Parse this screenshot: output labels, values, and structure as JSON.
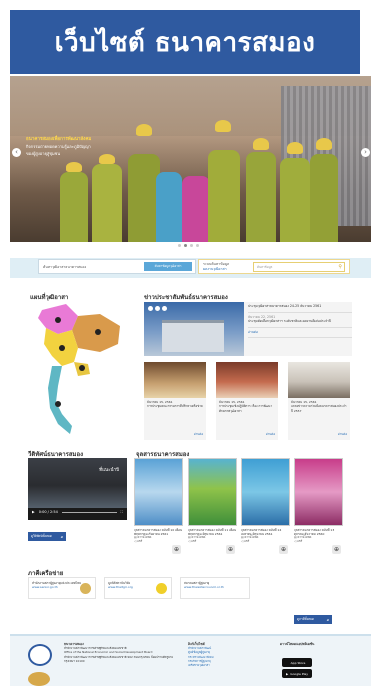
{
  "banner": {
    "title": "เว็บไซต์ ธนาคารสมอง"
  },
  "hero": {
    "caption_title": "ธนาคารสมองเพื่อการพัฒนาสังคม",
    "caption_lines": [
      "กิจกรรมถ่ายทอดความรู้และภูมิปัญญา",
      "ของผู้สูงอายุสู่ชุมชน"
    ],
    "prev_icon": "‹",
    "next_icon": "›"
  },
  "search": {
    "label": "ค้นหาวุฒิอาสาธนาคารสมอง",
    "button": "ค้นหาข้อมูลวุฒิอาสา",
    "info_label": "ระบบค้นหาข้อมูล",
    "info_link": "ผลงานวุฒิอาสา",
    "input_placeholder": "ค้นหาข้อมูล"
  },
  "sections": {
    "map_title": "แผนที่วุฒิอาสา",
    "news_title": "ข่าวประชาสัมพันธ์ธนาคารสมอง",
    "video_title": "วีดิทัศน์ธนาคารสมอง",
    "pub_title": "จุลสารธนาคารสมอง",
    "partner_title": "ภาคีเครือข่าย"
  },
  "news_main": {
    "items": [
      {
        "date": "",
        "text": "ประชุมวุฒิอาสาธนาคารสมอง 24-25 ธันวาคม 2561"
      },
      {
        "date": "ธันวาคม 22, 2561",
        "text": "ประชุมคัดเลือกวุฒิอาสาฯ ระดับชาติและผลงานดีเด่นประจำปี"
      },
      {
        "date": "",
        "text": "อ่านต่อ"
      }
    ]
  },
  "news_cards": [
    {
      "date": "ธันวาคม 15, 2561",
      "text": "การประชุมคณะกรรมการที่ปรึกษาเครือข่าย",
      "more": "อ่านต่อ"
    },
    {
      "date": "ธันวาคม 15, 2561",
      "text": "การประชุมเชิงปฏิบัติการ เรื่อง การพัฒนาศักยภาพวุฒิอาสา",
      "more": "อ่านต่อ"
    },
    {
      "date": "ธันวาคม 15, 2561",
      "text": "แถลงข่าวความร่วมมือธนาคารสมองประจำปี 2557",
      "more": "อ่านต่อ"
    }
  ],
  "video": {
    "overlay": "ที่แนะนำปี",
    "time": "0:00 / 2:54",
    "button": "ดูวีดิทัศน์ทั้งหมด"
  },
  "publications": [
    {
      "title": "จุลสารธนาคารสมอง ฉบับที่ 10 เดือนพฤษภาคม-กันยายน 2561",
      "views": "ดาวน์โหลด",
      "share": "แชร์"
    },
    {
      "title": "จุลสารธนาคารสมอง ฉบับที่ 11 เดือนพฤษภาคม-มิถุนายน 2561",
      "views": "ดาวน์โหลด",
      "share": "แชร์"
    },
    {
      "title": "จุลสารธนาคารสมอง ฉบับที่ 14 เมษายน-มิถุนายน 2561",
      "views": "ดาวน์โหลด",
      "share": "แชร์"
    },
    {
      "title": "จุลสารธนาคารสมอง ฉบับที่ 13 ตุลาคม-ธันวาคม 2560",
      "views": "ดาวน์โหลด",
      "share": "แชร์"
    }
  ],
  "pub_button": "ดูจุลสารทั้งหมด",
  "partners": [
    {
      "name": "สำนักงานสภาผู้สูงอายุแห่งประเทศไทย",
      "link": "www.senior.go.th"
    },
    {
      "name": "มูลนิธิสถาบันวิจัย",
      "link": "www.thaitgri.org"
    },
    {
      "name": "สมาคมสภาผู้สูงอายุ",
      "link": "www.thaieldercouncil.or.th"
    }
  ],
  "partner_button": "ดูภาคีทั้งหมด",
  "footer": {
    "org_name": "ธนาคารสมอง",
    "org_desc": "สำนักงานสภาพัฒนาการเศรษฐกิจและสังคมแห่งชาติ",
    "org_en": "Office of the National Economic and Social Development Board",
    "address": "สำนักงานสภาพัฒนาการเศรษฐกิจและสังคมแห่งชาติ 962 ถนนกรุงเกษม ป้อมปราบศัตรูพ่าย กรุงเทพฯ 10100",
    "links_title": "ลิงก์เว็บไซต์",
    "links": [
      "สำนักงานสภาพัฒน์",
      "ศูนย์ข้อมูลผู้สูงอายุ",
      "กระทรวงพัฒนาสังคม",
      "กรมกิจการผู้สูงอายุ",
      "เครือข่ายวุฒิอาสา"
    ],
    "app_title": "ดาวน์โหลดแอปพลิเคชัน",
    "app_store": "App Store",
    "google_play": "Google Play"
  }
}
